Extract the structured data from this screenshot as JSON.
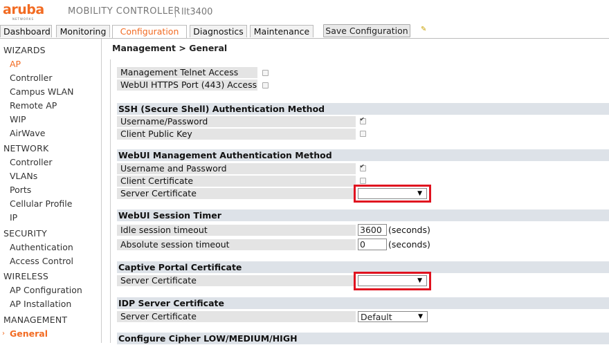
{
  "header": {
    "logo_text": "aruba",
    "logo_sub": "NETWORKS",
    "product": "MOBILITY CONTROLLER",
    "controller": "llt3400"
  },
  "tabs": [
    {
      "label": "Dashboard"
    },
    {
      "label": "Monitoring"
    },
    {
      "label": "Configuration"
    },
    {
      "label": "Diagnostics"
    },
    {
      "label": "Maintenance"
    }
  ],
  "save_label": "Save Configuration",
  "sidebar": {
    "wizards": "WIZARDS",
    "wizard_items": [
      "AP",
      "Controller",
      "Campus WLAN",
      "Remote AP",
      "WIP",
      "AirWave"
    ],
    "network": "NETWORK",
    "network_items": [
      "Controller",
      "VLANs",
      "Ports",
      "Cellular Profile",
      "IP"
    ],
    "security": "SECURITY",
    "security_items": [
      "Authentication",
      "Access Control"
    ],
    "wireless": "WIRELESS",
    "wireless_items": [
      "AP Configuration",
      "AP Installation"
    ],
    "management": "MANAGEMENT",
    "management_items": [
      "General"
    ]
  },
  "breadcrumb": "Management > General",
  "top_rows": [
    "Management Telnet Access",
    "WebUI HTTPS Port (443) Access"
  ],
  "ssh": {
    "title": "SSH (Secure Shell) Authentication Method",
    "rows": [
      "Username/Password",
      "Client Public Key"
    ]
  },
  "webui_auth": {
    "title": "WebUI Management Authentication Method",
    "rows": [
      "Username and Password",
      "Client Certificate",
      "Server Certificate"
    ]
  },
  "session": {
    "title": "WebUI Session Timer",
    "idle_label": "Idle session timeout",
    "idle_value": "3600",
    "abs_label": "Absolute session timeout",
    "abs_value": "0",
    "unit": "(seconds)"
  },
  "captive": {
    "title": "Captive Portal Certificate",
    "row": "Server Certificate"
  },
  "idp": {
    "title": "IDP Server Certificate",
    "row": "Server Certificate",
    "value": "Default"
  },
  "cipher": {
    "title": "Configure Cipher LOW/MEDIUM/HIGH"
  }
}
